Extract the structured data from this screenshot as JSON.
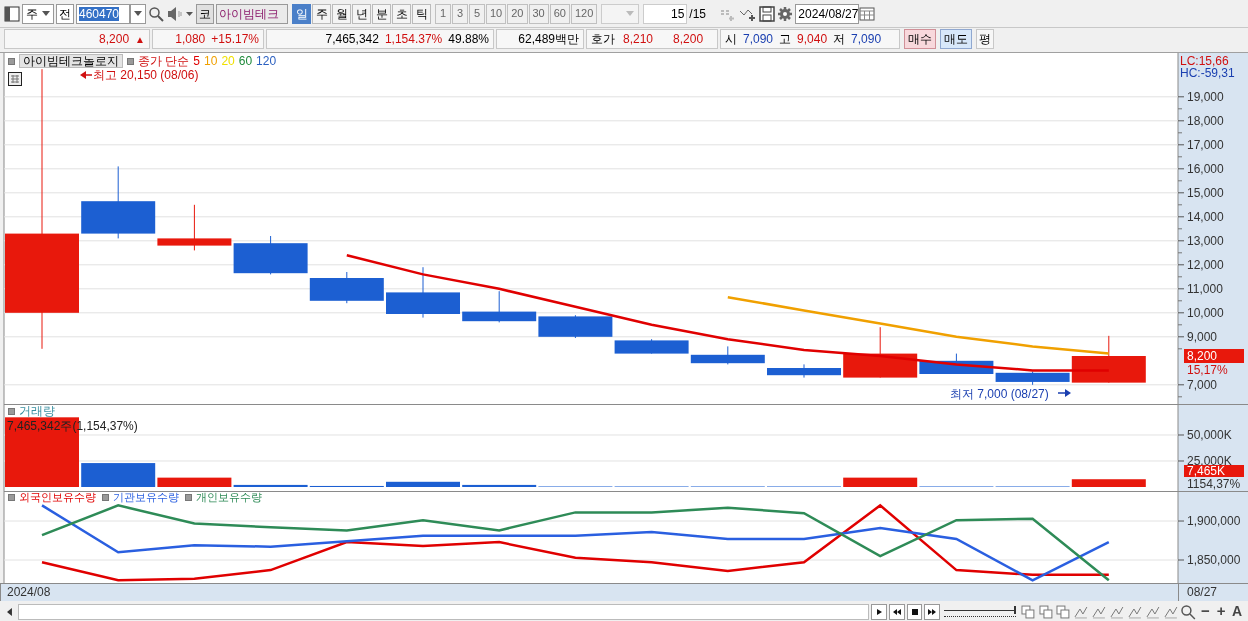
{
  "toolbar": {
    "market": "주",
    "all_button": "전",
    "code": "460470",
    "name_prefix": "코",
    "stock_name": "아이빔테크",
    "periods": [
      {
        "label": "일",
        "selected": true
      },
      {
        "label": "주",
        "selected": false
      },
      {
        "label": "월",
        "selected": false
      },
      {
        "label": "년",
        "selected": false
      },
      {
        "label": "분",
        "selected": false
      },
      {
        "label": "초",
        "selected": false
      },
      {
        "label": "틱",
        "selected": false
      }
    ],
    "steps": [
      "1",
      "3",
      "5",
      "10",
      "20",
      "30",
      "60",
      "120"
    ],
    "count": "15",
    "count_total": "/15",
    "date": "2024/08/27"
  },
  "quote": {
    "price": "8,200",
    "direction": "▲",
    "change": "1,080",
    "change_rate": "+15.17%",
    "volume": "7,465,342",
    "volume_rate": "1,154.37%",
    "turnover": "49.88%",
    "amount": "62,489백만",
    "ask_label": "호가",
    "ask": "8,210",
    "bid": "8,200",
    "open_label": "시",
    "open": "7,090",
    "high_label": "고",
    "high": "9,040",
    "low_label": "저",
    "low": "7,090"
  },
  "order_buttons": [
    {
      "label": "매수",
      "kind": "buy"
    },
    {
      "label": "매도",
      "kind": "sell"
    },
    {
      "label": "평",
      "kind": "plain"
    }
  ],
  "price_panel": {
    "ma_label": "종가 단순",
    "more_periods": [
      {
        "label": "20",
        "color": "#f0e000"
      },
      {
        "label": "60",
        "color": "#1e8a3a"
      },
      {
        "label": "120",
        "color": "#2a5fc0"
      }
    ],
    "high_note": "최고 20,150 (08/06)",
    "low_note": "최저 7,000 (08/27)",
    "lc": "LC:15,66",
    "hc": "HC:-59,31",
    "price_tag": "8,200",
    "change_tag": "15,17%",
    "chart_data": {
      "type": "candlestick",
      "title": "아이빔테크놀로지",
      "grid": true,
      "ylim": [
        6200,
        20825
      ],
      "yticks": [
        {
          "value": 7000,
          "label": "7,000"
        },
        {
          "value": 9000,
          "label": "9,000"
        },
        {
          "value": 10000,
          "label": "10,000"
        },
        {
          "value": 11000,
          "label": "11,000"
        },
        {
          "value": 12000,
          "label": "12,000"
        },
        {
          "value": 13000,
          "label": "13,000"
        },
        {
          "value": 14000,
          "label": "14,000"
        },
        {
          "value": 15000,
          "label": "15,000"
        },
        {
          "value": 16000,
          "label": "16,000"
        },
        {
          "value": 17000,
          "label": "17,000"
        },
        {
          "value": 18000,
          "label": "18,000"
        },
        {
          "value": 19000,
          "label": "19,000"
        }
      ],
      "ohlc": [
        [
          10000,
          20150,
          8500,
          13300
        ],
        [
          14650,
          16100,
          13100,
          13300
        ],
        [
          12800,
          14500,
          12600,
          13100
        ],
        [
          12900,
          13200,
          11600,
          11650
        ],
        [
          11450,
          11700,
          10400,
          10500
        ],
        [
          10850,
          11900,
          9800,
          9950
        ],
        [
          10050,
          10900,
          9600,
          9650
        ],
        [
          9850,
          9900,
          8950,
          9000
        ],
        [
          8850,
          8900,
          8300,
          8300
        ],
        [
          8250,
          8600,
          7850,
          7900
        ],
        [
          7700,
          7850,
          7300,
          7400
        ],
        [
          7300,
          9400,
          7300,
          8300
        ],
        [
          8000,
          8300,
          7450,
          7450
        ],
        [
          7500,
          7550,
          7000,
          7120
        ],
        [
          7090,
          9040,
          7090,
          8200
        ]
      ],
      "series": [
        {
          "name": "5",
          "type": "line",
          "color": "#e00000",
          "values": [
            null,
            null,
            null,
            null,
            12400,
            11600,
            11000,
            10250,
            9500,
            8900,
            8450,
            8200,
            7850,
            7600,
            7600
          ]
        },
        {
          "name": "10",
          "type": "line",
          "color": "#f0a000",
          "values": [
            null,
            null,
            null,
            null,
            null,
            null,
            null,
            null,
            null,
            10650,
            10100,
            9550,
            9000,
            8600,
            8300
          ]
        }
      ]
    }
  },
  "volume_panel": {
    "title": "거래량",
    "note": "7,465,342주(1,154,37%)",
    "tag": "7,465K",
    "rate": "1154,37%",
    "chart_data": {
      "type": "bar",
      "grid": true,
      "ylim": [
        -3850,
        79800
      ],
      "yticks": [
        {
          "value": 25000,
          "label": "25,000K"
        },
        {
          "value": 50000,
          "label": "50,000K"
        }
      ],
      "values": [
        67000,
        23000,
        9000,
        2000,
        1000,
        5000,
        2000,
        500,
        500,
        500,
        500,
        9000,
        500,
        500,
        7465
      ]
    }
  },
  "holdings_panel": {
    "chart_data": {
      "type": "line",
      "grid": true,
      "ylim": [
        1820500,
        1938500
      ],
      "yticks": [
        {
          "value": 1850000,
          "label": "1,850,000"
        },
        {
          "value": 1900000,
          "label": "1,900,000"
        }
      ],
      "series": [
        {
          "name": "외국인보유수량",
          "color": "#e00000",
          "values": [
            1847000,
            1824000,
            1826000,
            1837000,
            1873000,
            1868000,
            1873000,
            1853000,
            1847000,
            1836000,
            1847000,
            1920000,
            1837000,
            1831000,
            1831000
          ]
        },
        {
          "name": "기관보유수량",
          "color": "#2a5fe0",
          "values": [
            1920000,
            1860000,
            1869000,
            1867000,
            1874000,
            1881000,
            1881000,
            1881000,
            1886000,
            1877000,
            1877000,
            1891000,
            1877000,
            1824000,
            1873000
          ]
        },
        {
          "name": "개인보유수량",
          "color": "#2e8b57",
          "values": [
            1882000,
            1920000,
            1897000,
            1892000,
            1888000,
            1901000,
            1888000,
            1911000,
            1911000,
            1917000,
            1910000,
            1855000,
            1901000,
            1903000,
            1824000
          ]
        }
      ]
    }
  },
  "x_axis": {
    "start": "2024/08",
    "end": "08/27"
  },
  "scroll_bar": {
    "level": 1,
    "zoom_out": "−",
    "zoom_in": "+",
    "font": "A"
  }
}
